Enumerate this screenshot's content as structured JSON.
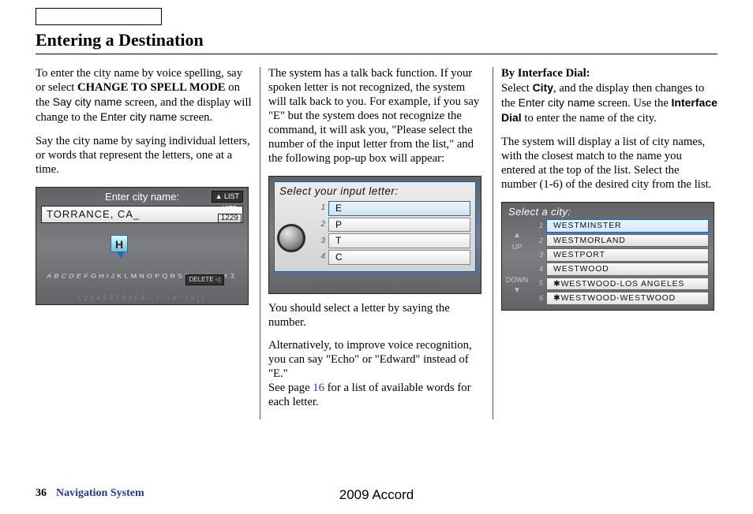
{
  "topBox": "",
  "title": "Entering a Destination",
  "col1": {
    "p1a": "To enter the city name by voice spelling, say or select ",
    "p1b": "CHANGE TO SPELL MODE",
    "p1c": " on the ",
    "p1d": "Say city name",
    "p1e": " screen, and the display will change to the ",
    "p1f": "Enter city name",
    "p1g": " screen.",
    "p2": "Say the city name by saying individual letters, or words that represent the letters, one at a time."
  },
  "fig1": {
    "header": "Enter city name:",
    "listBtn": "▲ LIST",
    "field": "TORRANCE, CA_",
    "hitsLabel": "HITS",
    "hitsValue": "1229",
    "highlight": "H",
    "letters": "ABCDEFGHIJKLMNOPQRSTUVWXYZ",
    "deleteBtn": "DELETE ◁",
    "bottom": "1234567890&-./\"+#*<>()"
  },
  "col2": {
    "p1": "The system has a talk back function. If your spoken letter is not recognized, the system will talk back to you. For example, if you say \"E\" but the system does not recognize the command, it will ask you, \"Please select the number of the input letter from the list,\" and the following pop-up box will appear:",
    "p2": "You should select a letter by saying the number.",
    "p3a": "Alternatively, to improve voice recognition, you can say \"Echo\" or \"Edward\" instead of \"E.\"",
    "p3b": "See page ",
    "p3link": "16",
    "p3c": " for a list of available words for each letter."
  },
  "fig2": {
    "title": "Select your input letter:",
    "rows": [
      {
        "n": "1",
        "v": "E"
      },
      {
        "n": "2",
        "v": "P"
      },
      {
        "n": "3",
        "v": "T"
      },
      {
        "n": "4",
        "v": "C"
      }
    ],
    "bottom": "1234567890&-./\"+#*<>()"
  },
  "col3": {
    "h": "By Interface Dial:",
    "p1a": "Select ",
    "p1b": "City",
    "p1c": ", and the display then changes to the ",
    "p1d": "Enter city name",
    "p1e": " screen. Use the ",
    "p1f": "Interface Dial",
    "p1g": " to enter the name of the city.",
    "p2": "The system will display a list of city names, with the closest match to the name you entered at the top of the list. Select the number (1-6) of the desired city from the list."
  },
  "fig3": {
    "header": "Select a city:",
    "upLabel": "UP",
    "downLabel": "DOWN",
    "rows": [
      {
        "n": "1",
        "v": "WESTMINSTER"
      },
      {
        "n": "2",
        "v": "WESTMORLAND"
      },
      {
        "n": "3",
        "v": "WESTPORT"
      },
      {
        "n": "4",
        "v": "WESTWOOD"
      },
      {
        "n": "5",
        "v": "✱WESTWOOD-LOS ANGELES"
      },
      {
        "n": "6",
        "v": "✱WESTWOOD-WESTWOOD"
      }
    ]
  },
  "footer": {
    "page": "36",
    "section": "Navigation System",
    "model": "2009  Accord"
  }
}
